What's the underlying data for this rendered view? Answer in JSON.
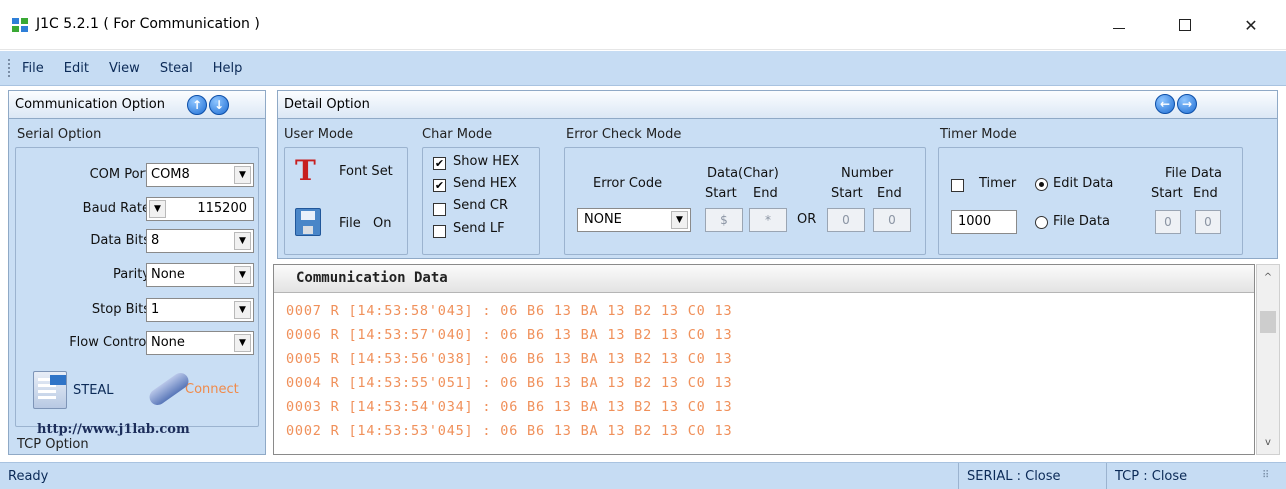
{
  "window": {
    "title": "J1C 5.2.1 ( For Communication )",
    "minimize": "–",
    "maximize": "□",
    "close": "✕"
  },
  "menu": [
    "File",
    "Edit",
    "View",
    "Steal",
    "Help"
  ],
  "left_panel": {
    "header": "Communication Option",
    "serial_section": "Serial Option",
    "com_port": {
      "label": "COM Port",
      "value": "COM8"
    },
    "baud_rate": {
      "label": "Baud Rate",
      "value": "115200"
    },
    "data_bits": {
      "label": "Data Bits",
      "value": "8"
    },
    "parity": {
      "label": "Parity",
      "value": "None"
    },
    "stop_bits": {
      "label": "Stop Bits",
      "value": "1"
    },
    "flow_control": {
      "label": "Flow Control",
      "value": "None"
    },
    "steal_label": "STEAL",
    "connect_label": "Connect",
    "url": "http://www.j1lab.com",
    "tcp_section": "TCP Option"
  },
  "detail": {
    "header": "Detail Option",
    "user_mode": {
      "label": "User Mode",
      "font_set": "Font Set",
      "file": "File",
      "on": "On"
    },
    "char_mode": {
      "label": "Char Mode",
      "show_hex": {
        "label": "Show HEX",
        "checked": true
      },
      "send_hex": {
        "label": "Send HEX",
        "checked": true
      },
      "send_cr": {
        "label": "Send CR",
        "checked": false
      },
      "send_lf": {
        "label": "Send LF",
        "checked": false
      }
    },
    "error_check": {
      "label": "Error Check Mode",
      "error_code_label": "Error Code",
      "error_code_value": "NONE",
      "data_char_label": "Data(Char)",
      "number_label": "Number",
      "start": "Start",
      "end": "End",
      "or": "OR",
      "data_start": "$",
      "data_end": "*",
      "num_start": "0",
      "num_end": "0"
    },
    "timer_mode": {
      "label": "Timer Mode",
      "timer": "Timer",
      "timer_checked": false,
      "timer_value": "1000",
      "edit_data": "Edit Data",
      "file_data_radio": "File Data",
      "file_data_label": "File Data",
      "start": "Start",
      "end": "End",
      "fd_start": "0",
      "fd_end": "0"
    }
  },
  "communication": {
    "header": "Communication Data",
    "lines": [
      "0007 R [14:53:58'043] : 06 B6 13 BA 13 B2 13 C0 13",
      "0006 R [14:53:57'040] : 06 B6 13 BA 13 B2 13 C0 13",
      "0005 R [14:53:56'038] : 06 B6 13 BA 13 B2 13 C0 13",
      "0004 R [14:53:55'051] : 06 B6 13 BA 13 B2 13 C0 13",
      "0003 R [14:53:54'034] : 06 B6 13 BA 13 B2 13 C0 13",
      "0002 R [14:53:53'045] : 06 B6 13 BA 13 B2 13 C0 13"
    ]
  },
  "status": {
    "ready": "Ready",
    "serial": "SERIAL : Close",
    "tcp": "TCP : Close"
  },
  "icons": {
    "arrow_up": "↑",
    "arrow_down": "↓",
    "arrow_left": "←",
    "arrow_right": "→",
    "dropdown": "▼",
    "scroll_up": "^",
    "scroll_down": "v",
    "check": "✔",
    "grip": "⠿",
    "tt": "T"
  },
  "colors": {
    "panel_bg": "#c9def4",
    "menu_bg": "#c6dcf3",
    "log_text": "#f0905a",
    "connect_text": "#f08a4a"
  }
}
